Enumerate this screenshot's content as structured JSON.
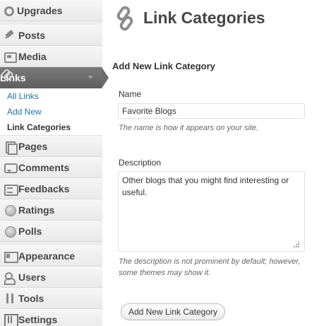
{
  "sidebar": {
    "items": [
      {
        "label": "Upgrades",
        "icon": "gear-icon"
      },
      {
        "label": "Posts",
        "icon": "pushpin-icon"
      },
      {
        "label": "Media",
        "icon": "media-icon"
      },
      {
        "label": "Links",
        "icon": "link-icon",
        "active": true
      },
      {
        "label": "Pages",
        "icon": "pages-icon"
      },
      {
        "label": "Comments",
        "icon": "comment-bubble-icon"
      },
      {
        "label": "Feedbacks",
        "icon": "feedback-icon"
      },
      {
        "label": "Ratings",
        "icon": "circle-icon"
      },
      {
        "label": "Polls",
        "icon": "circle-icon"
      },
      {
        "label": "Appearance",
        "icon": "appearance-icon"
      },
      {
        "label": "Users",
        "icon": "users-icon"
      },
      {
        "label": "Tools",
        "icon": "tools-icon"
      },
      {
        "label": "Settings",
        "icon": "settings-icon"
      }
    ],
    "submenu": [
      {
        "label": "All Links"
      },
      {
        "label": "Add New"
      },
      {
        "label": "Link Categories",
        "current": true
      }
    ]
  },
  "main": {
    "title": "Link Categories",
    "section_title": "Add New Link Category",
    "name": {
      "label": "Name",
      "value": "Favorite Blogs",
      "hint": "The name is how it appears on your site."
    },
    "description": {
      "label": "Description",
      "value": "Other blogs that you might find interesting or useful.",
      "hint": "The description is not prominent by default; however, some themes may show it."
    },
    "submit_label": "Add New Link Category"
  },
  "colors": {
    "link": "#21759b",
    "active_menu": "#6b6b6b",
    "sidebar_bg": "#ececec"
  }
}
